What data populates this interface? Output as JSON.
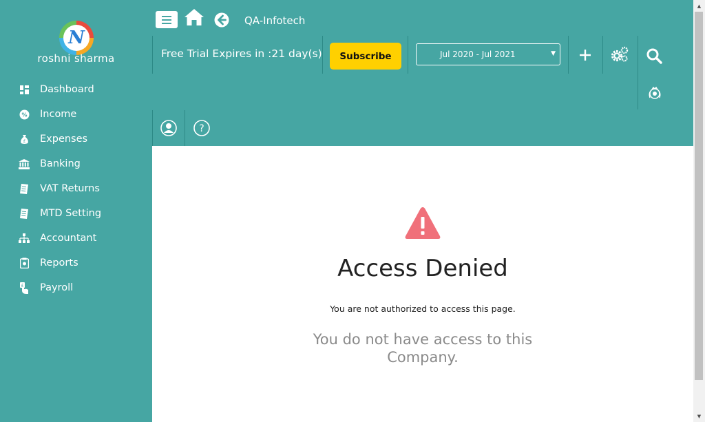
{
  "sidebar": {
    "user_name": "roshni sharma",
    "items": [
      {
        "label": "Dashboard",
        "icon": "dashboard-icon"
      },
      {
        "label": "Income",
        "icon": "percent-icon"
      },
      {
        "label": "Expenses",
        "icon": "money-bag-icon"
      },
      {
        "label": "Banking",
        "icon": "bank-icon"
      },
      {
        "label": "VAT Returns",
        "icon": "receipt-icon"
      },
      {
        "label": "MTD Setting",
        "icon": "receipt-icon"
      },
      {
        "label": "Accountant",
        "icon": "hierarchy-icon"
      },
      {
        "label": "Reports",
        "icon": "clipboard-icon"
      },
      {
        "label": "Payroll",
        "icon": "hand-money-icon"
      }
    ]
  },
  "header": {
    "company": "QA-Infotech",
    "trial_text": "Free Trial Expires in :21 day(s)",
    "subscribe_label": "Subscribe",
    "period": "Jul 2020 - Jul 2021"
  },
  "main": {
    "title": "Access Denied",
    "message": "You are not authorized to access this page.",
    "sub_message": "You do not have access to this Company."
  },
  "colors": {
    "brand": "#46a6a3",
    "subscribe": "#ffd000",
    "warning": "#f0707a"
  }
}
